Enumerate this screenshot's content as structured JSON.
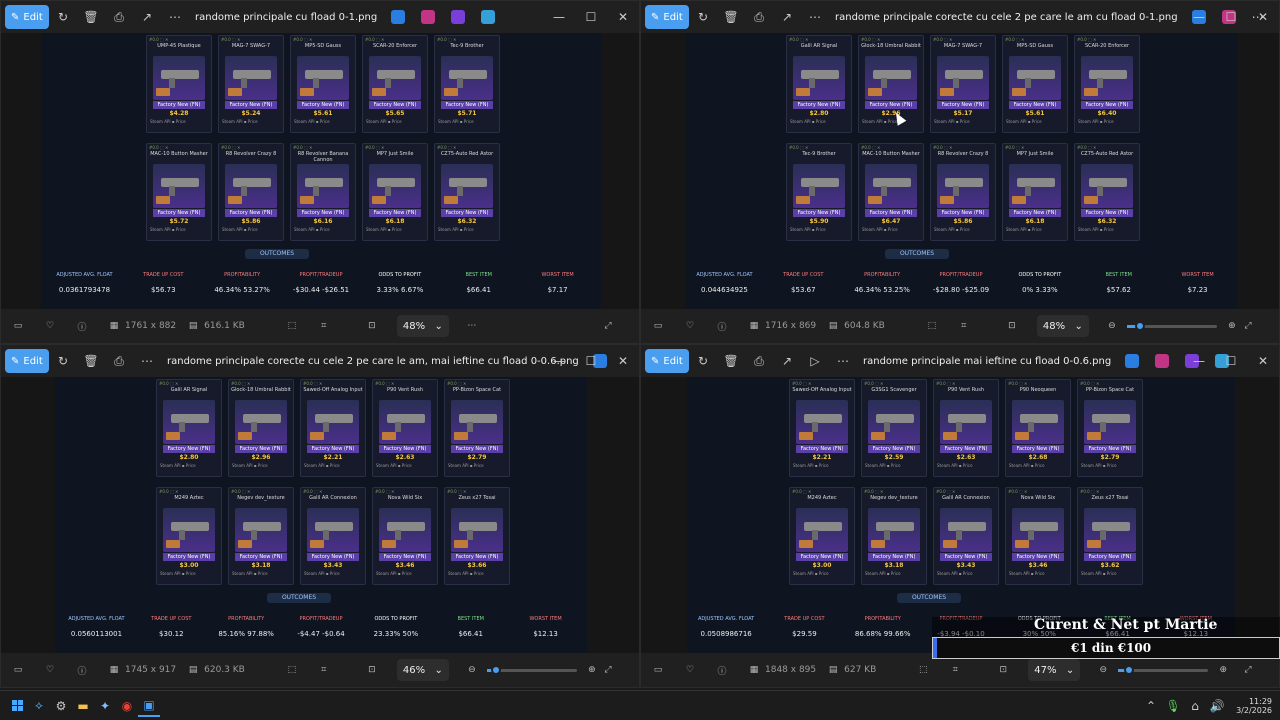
{
  "windows": [
    {
      "edit_label": "Edit",
      "title": "randome principale cu fload 0-1.png",
      "dimensions": "1761 x 882",
      "size": "616.1 KB",
      "zoom": "48%",
      "has_slider": false,
      "zoom_fraction": 0,
      "outcomes_label": "OUTCOMES",
      "stats_labels": [
        "ADJUSTED AVG. FLOAT",
        "TRADE UP COST",
        "PROFITABILITY",
        "PROFIT/TRADEUP",
        "ODDS TO PROFIT",
        "BEST ITEM",
        "WORST ITEM"
      ],
      "stats_values": [
        "0.0361793478",
        "$56.73",
        "46.34%   53.27%",
        "-$30.44   -$26.51",
        "3.33%   6.67%",
        "$66.41",
        "$7.17"
      ],
      "cards": [
        {
          "name": "UMP-45 Plastique",
          "price": "$4.28"
        },
        {
          "name": "MAG-7 SWAG-7",
          "price": "$5.24"
        },
        {
          "name": "MP5-SD Gauss",
          "price": "$5.61"
        },
        {
          "name": "SCAR-20 Enforcer",
          "price": "$5.65"
        },
        {
          "name": "Tec-9 Brother",
          "price": "$5.71"
        },
        {
          "name": "MAC-10 Button Masher",
          "price": "$5.72"
        },
        {
          "name": "R8 Revolver Crazy 8",
          "price": "$5.86"
        },
        {
          "name": "R8 Revolver Banana Cannon",
          "price": "$6.16"
        },
        {
          "name": "MP7 Just Smile",
          "price": "$6.18"
        },
        {
          "name": "CZ75-Auto Red Astor",
          "price": "$6.32"
        }
      ]
    },
    {
      "edit_label": "Edit",
      "title": "randome principale corecte cu cele 2 pe care le am cu fload 0-1.png",
      "dimensions": "1716 x 869",
      "size": "604.8 KB",
      "zoom": "48%",
      "has_slider": true,
      "zoom_fraction": 0.15,
      "outcomes_label": "OUTCOMES",
      "stats_labels": [
        "ADJUSTED AVG. FLOAT",
        "TRADE UP COST",
        "PROFITABILITY",
        "PROFIT/TRADEUP",
        "ODDS TO PROFIT",
        "BEST ITEM",
        "WORST ITEM"
      ],
      "stats_values": [
        "0.044634925",
        "$53.67",
        "46.34%   53.25%",
        "-$28.80   -$25.09",
        "0%   3.33%",
        "$57.62",
        "$7.23"
      ],
      "cards": [
        {
          "name": "Galil AR Signal",
          "price": "$2.80"
        },
        {
          "name": "Glock-18 Umbral Rabbit",
          "price": "$2.96"
        },
        {
          "name": "MAG-7 SWAG-7",
          "price": "$5.17"
        },
        {
          "name": "MP5-SD Gauss",
          "price": "$5.61"
        },
        {
          "name": "SCAR-20 Enforcer",
          "price": "$6.40"
        },
        {
          "name": "Tec-9 Brother",
          "price": "$5.90"
        },
        {
          "name": "MAC-10 Button Masher",
          "price": "$6.47"
        },
        {
          "name": "R8 Revolver Crazy 8",
          "price": "$5.86"
        },
        {
          "name": "MP7 Just Smile",
          "price": "$6.18"
        },
        {
          "name": "CZ75-Auto Red Astor",
          "price": "$6.32"
        }
      ]
    },
    {
      "edit_label": "Edit",
      "title": "randome principale corecte cu cele 2 pe care le am, mai ieftine cu fload 0-0.6.png",
      "dimensions": "1745 x 917",
      "size": "620.3 KB",
      "zoom": "46%",
      "has_slider": true,
      "zoom_fraction": 0.1,
      "outcomes_label": "OUTCOMES",
      "stats_labels": [
        "ADJUSTED AVG. FLOAT",
        "TRADE UP COST",
        "PROFITABILITY",
        "PROFIT/TRADEUP",
        "ODDS TO PROFIT",
        "BEST ITEM",
        "WORST ITEM"
      ],
      "stats_values": [
        "0.0560113001",
        "$30.12",
        "85.16%   97.88%",
        "-$4.47   -$0.64",
        "23.33%   50%",
        "$66.41",
        "$12.13"
      ],
      "cards": [
        {
          "name": "Galil AR Signal",
          "price": "$2.80"
        },
        {
          "name": "Glock-18 Umbral Rabbit",
          "price": "$2.96"
        },
        {
          "name": "Sawed-Off Analog Input",
          "price": "$2.21"
        },
        {
          "name": "P90 Vent Rush",
          "price": "$2.63"
        },
        {
          "name": "PP-Bizon Space Cat",
          "price": "$2.79"
        },
        {
          "name": "M249 Aztec",
          "price": "$3.00"
        },
        {
          "name": "Negev dev_texture",
          "price": "$3.18"
        },
        {
          "name": "Galil AR Connexion",
          "price": "$3.43"
        },
        {
          "name": "Nova Wild Six",
          "price": "$3.46"
        },
        {
          "name": "Zeus x27 Tosai",
          "price": "$3.66"
        }
      ]
    },
    {
      "edit_label": "Edit",
      "title": "randome principale mai ieftine cu fload 0-0.6.png",
      "dimensions": "1848 x 895",
      "size": "627 KB",
      "zoom": "47%",
      "has_slider": true,
      "zoom_fraction": 0.12,
      "outcomes_label": "OUTCOMES",
      "stats_labels": [
        "ADJUSTED AVG. FLOAT",
        "TRADE UP COST",
        "PROFITABILITY",
        "PROFIT/TRADEUP",
        "ODDS TO PROFIT",
        "BEST ITEM",
        "WORST ITEM"
      ],
      "stats_values": [
        "0.0508986716",
        "$29.59",
        "86.68%   99.66%",
        "-$3.94   -$0.10",
        "30%   50%",
        "$66.41",
        "$12.13"
      ],
      "cards": [
        {
          "name": "Sawed-Off Analog Input",
          "price": "$2.21"
        },
        {
          "name": "G3SG1 Scavenger",
          "price": "$2.59"
        },
        {
          "name": "P90 Vent Rush",
          "price": "$2.63"
        },
        {
          "name": "P90 Neoqueen",
          "price": "$2.68"
        },
        {
          "name": "PP-Bizon Space Cat",
          "price": "$2.79"
        },
        {
          "name": "M249 Aztec",
          "price": "$3.00"
        },
        {
          "name": "Negev dev_texture",
          "price": "$3.18"
        },
        {
          "name": "Galil AR Connexion",
          "price": "$3.43"
        },
        {
          "name": "Nova Wild Six",
          "price": "$3.46"
        },
        {
          "name": "Zeus x27 Tosai",
          "price": "$3.62"
        }
      ]
    }
  ],
  "card_condition": "Factory New (FN)",
  "overlay": {
    "line1": "Curent & Net pt Martie",
    "line2": "€1 din €100",
    "progress_fraction": 0.01
  },
  "taskbar": {
    "time": "11:29",
    "date": "3/2/2026"
  },
  "colors": {
    "accent": "#4a9eef",
    "card_bg": "#161a2a",
    "label_colors": [
      "#9ec7ff",
      "#ff7a7a",
      "#ff7a7a",
      "#ff7a7a",
      "#ffffff",
      "#7ee08a",
      "#ff7a7a"
    ]
  }
}
